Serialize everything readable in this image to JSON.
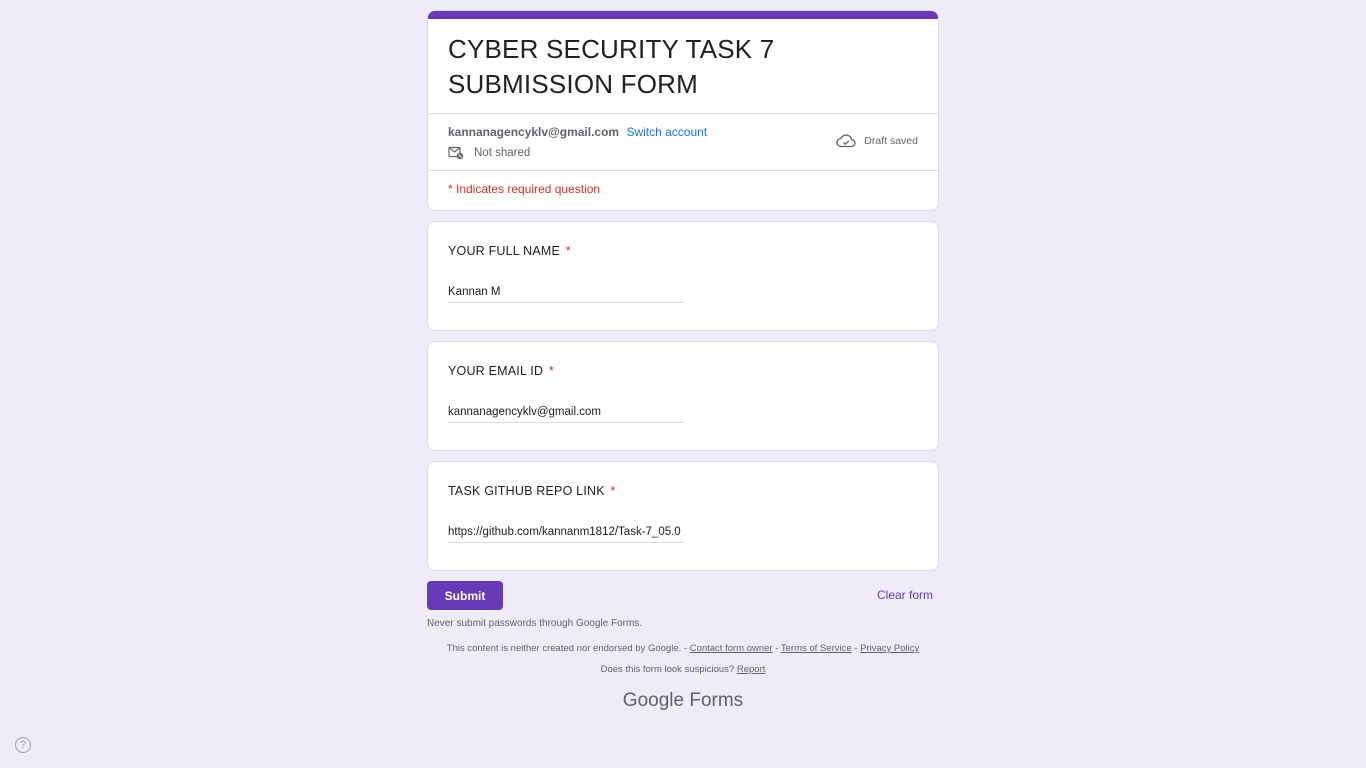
{
  "form": {
    "title": "CYBER SECURITY TASK 7 SUBMISSION FORM",
    "account_email": "kannanagencyklv@gmail.com",
    "switch_account": "Switch account",
    "not_shared": "Not shared",
    "draft_status": "Draft saved",
    "required_note": "* Indicates required question",
    "accent_color": "#673ab7"
  },
  "questions": [
    {
      "title": "YOUR FULL NAME",
      "required_mark": "*",
      "value": "Kannan M"
    },
    {
      "title": "YOUR EMAIL ID",
      "required_mark": "*",
      "value": "kannanagencyklv@gmail.com"
    },
    {
      "title": "TASK GITHUB REPO LINK",
      "required_mark": "*",
      "value": "https://github.com/kannanm1812/Task-7_05.0"
    }
  ],
  "actions": {
    "submit": "Submit",
    "clear": "Clear form"
  },
  "footer": {
    "never_submit": "Never submit passwords through Google Forms.",
    "disclaimer": "This content is neither created nor endorsed by Google. -",
    "contact": "Contact form owner",
    "sep": "-",
    "terms": "Terms of Service",
    "privacy": "Privacy Policy",
    "suspicious": "Does this form look suspicious?",
    "report": "Report",
    "brand_google": "Google",
    "brand_forms": "Forms"
  },
  "help_icon": "?"
}
